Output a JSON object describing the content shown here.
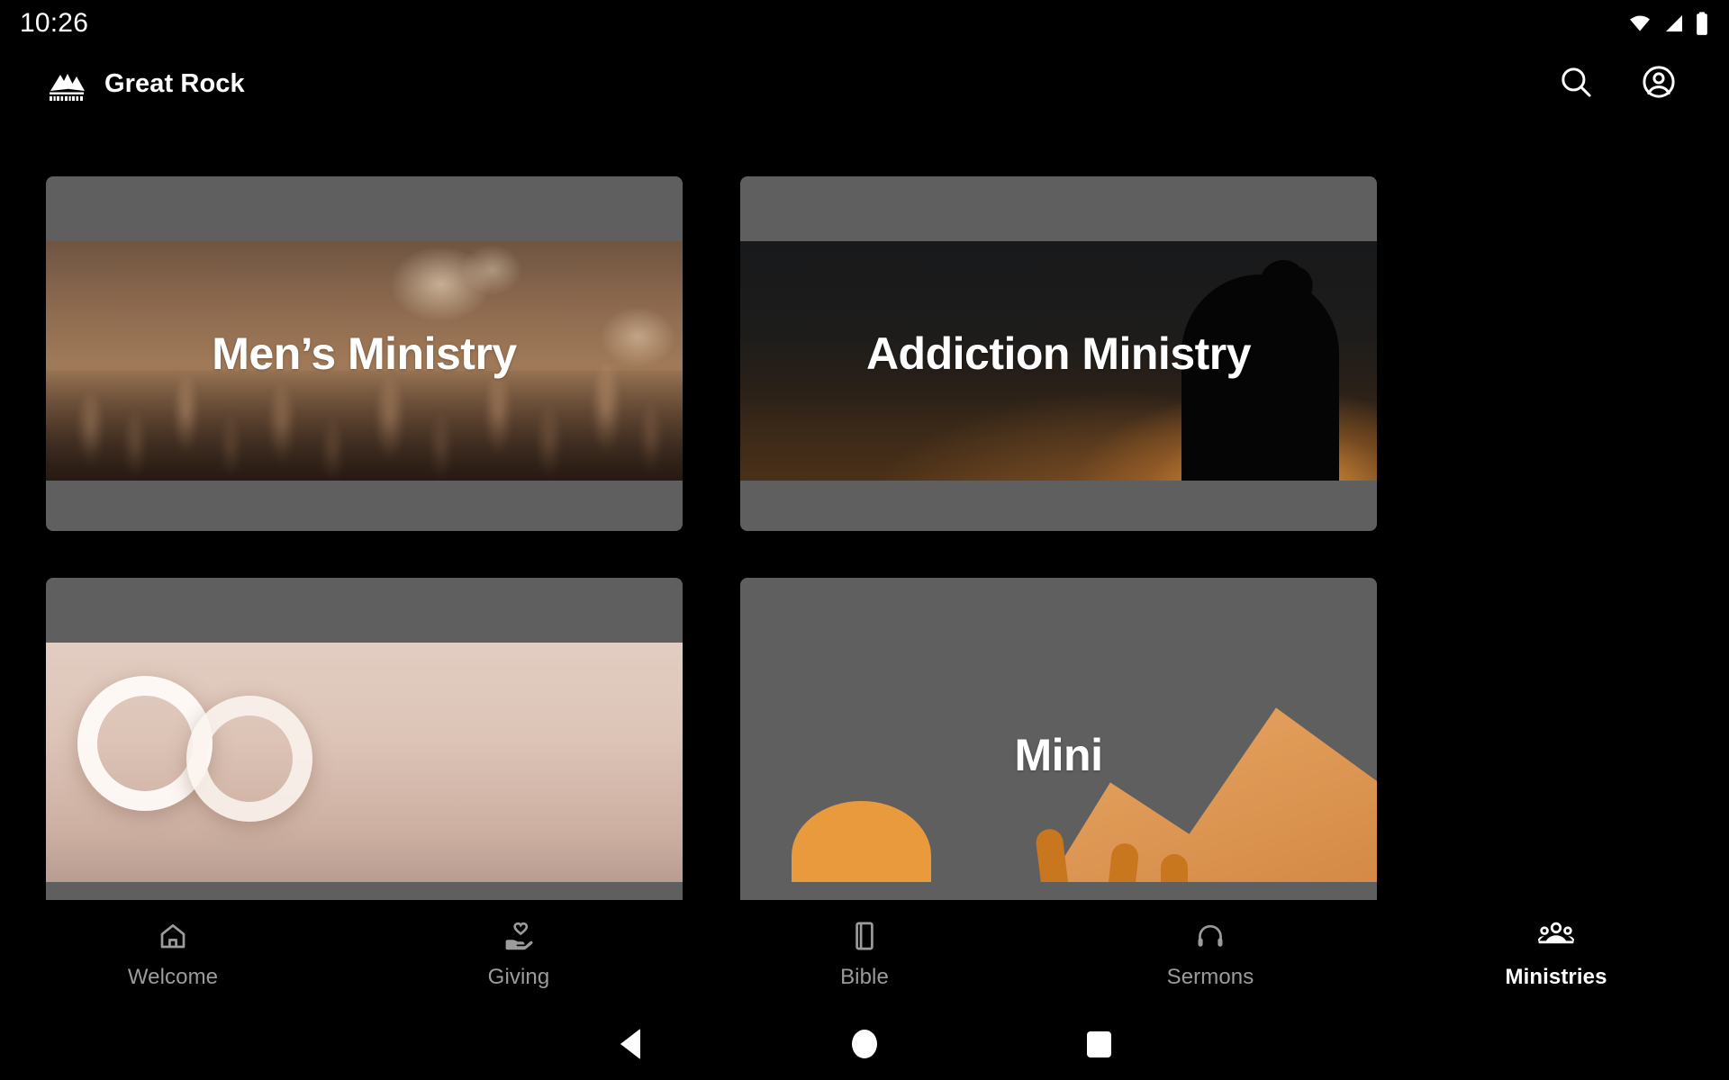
{
  "status_bar": {
    "clock": "10:26",
    "icons": [
      "wifi-icon",
      "cellular-signal-icon",
      "battery-icon"
    ]
  },
  "app_bar": {
    "logo_icon": "great-rock-mountain-logo",
    "title": "Great Rock",
    "actions": [
      {
        "name": "search-icon",
        "label": "Search"
      },
      {
        "name": "account-circle-icon",
        "label": "Account"
      }
    ]
  },
  "main": {
    "cards": [
      {
        "title": "Men’s Ministry",
        "media": "crowd-raised-hands-photo"
      },
      {
        "title": "Addiction Ministry",
        "media": "silhouette-raised-hand-glow-photo"
      },
      {
        "title": "",
        "media": "wedding-rings-blush-photo"
      },
      {
        "title": "Mini",
        "media": "sunrise-raised-hands-photo"
      }
    ]
  },
  "bottom_nav": {
    "items": [
      {
        "label": "Welcome",
        "icon": "home-icon",
        "active": false
      },
      {
        "label": "Giving",
        "icon": "volunteer-hand-heart-icon",
        "active": false
      },
      {
        "label": "Bible",
        "icon": "menu-book-icon",
        "active": false
      },
      {
        "label": "Sermons",
        "icon": "headphones-icon",
        "active": false
      },
      {
        "label": "Ministries",
        "icon": "groups-icon",
        "active": true
      }
    ]
  },
  "system_nav": {
    "back": "back-triangle-icon",
    "home": "home-circle-icon",
    "recents": "recents-square-icon"
  },
  "colors": {
    "background": "#000000",
    "card_placeholder": "#5f5f5f",
    "nav_inactive": "#9b9b9b",
    "nav_active": "#ffffff"
  }
}
